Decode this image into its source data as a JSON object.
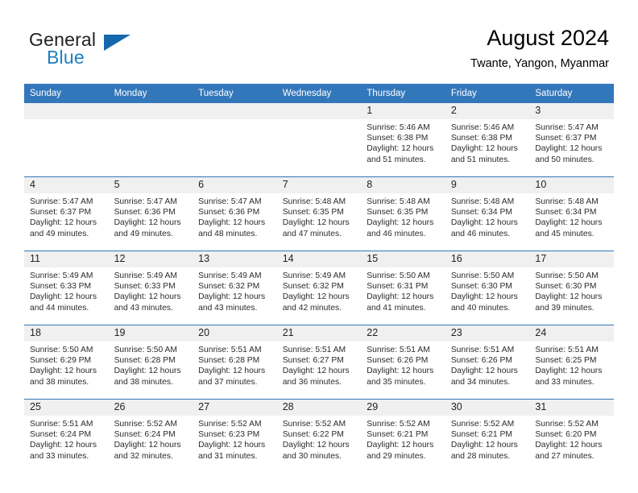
{
  "brand": {
    "word_one": "General",
    "word_two": "Blue",
    "triangle_color": "#1668ad",
    "blue_color": "#1b7fc4"
  },
  "header": {
    "title": "August 2024",
    "subtitle": "Twante, Yangon, Myanmar"
  },
  "theme": {
    "header_blue": "#3377bb",
    "daynum_band": "#f0f0f0"
  },
  "weekday_headers": [
    "Sunday",
    "Monday",
    "Tuesday",
    "Wednesday",
    "Thursday",
    "Friday",
    "Saturday"
  ],
  "labels": {
    "sunrise_prefix": "Sunrise:",
    "sunset_prefix": "Sunset:",
    "daylight_prefix": "Daylight:"
  },
  "weeks": [
    [
      {
        "day": "",
        "empty": true
      },
      {
        "day": "",
        "empty": true
      },
      {
        "day": "",
        "empty": true
      },
      {
        "day": "",
        "empty": true
      },
      {
        "day": "1",
        "sunrise": "Sunrise: 5:46 AM",
        "sunset": "Sunset: 6:38 PM",
        "daylight": "Daylight: 12 hours and 51 minutes."
      },
      {
        "day": "2",
        "sunrise": "Sunrise: 5:46 AM",
        "sunset": "Sunset: 6:38 PM",
        "daylight": "Daylight: 12 hours and 51 minutes."
      },
      {
        "day": "3",
        "sunrise": "Sunrise: 5:47 AM",
        "sunset": "Sunset: 6:37 PM",
        "daylight": "Daylight: 12 hours and 50 minutes."
      }
    ],
    [
      {
        "day": "4",
        "sunrise": "Sunrise: 5:47 AM",
        "sunset": "Sunset: 6:37 PM",
        "daylight": "Daylight: 12 hours and 49 minutes."
      },
      {
        "day": "5",
        "sunrise": "Sunrise: 5:47 AM",
        "sunset": "Sunset: 6:36 PM",
        "daylight": "Daylight: 12 hours and 49 minutes."
      },
      {
        "day": "6",
        "sunrise": "Sunrise: 5:47 AM",
        "sunset": "Sunset: 6:36 PM",
        "daylight": "Daylight: 12 hours and 48 minutes."
      },
      {
        "day": "7",
        "sunrise": "Sunrise: 5:48 AM",
        "sunset": "Sunset: 6:35 PM",
        "daylight": "Daylight: 12 hours and 47 minutes."
      },
      {
        "day": "8",
        "sunrise": "Sunrise: 5:48 AM",
        "sunset": "Sunset: 6:35 PM",
        "daylight": "Daylight: 12 hours and 46 minutes."
      },
      {
        "day": "9",
        "sunrise": "Sunrise: 5:48 AM",
        "sunset": "Sunset: 6:34 PM",
        "daylight": "Daylight: 12 hours and 46 minutes."
      },
      {
        "day": "10",
        "sunrise": "Sunrise: 5:48 AM",
        "sunset": "Sunset: 6:34 PM",
        "daylight": "Daylight: 12 hours and 45 minutes."
      }
    ],
    [
      {
        "day": "11",
        "sunrise": "Sunrise: 5:49 AM",
        "sunset": "Sunset: 6:33 PM",
        "daylight": "Daylight: 12 hours and 44 minutes."
      },
      {
        "day": "12",
        "sunrise": "Sunrise: 5:49 AM",
        "sunset": "Sunset: 6:33 PM",
        "daylight": "Daylight: 12 hours and 43 minutes."
      },
      {
        "day": "13",
        "sunrise": "Sunrise: 5:49 AM",
        "sunset": "Sunset: 6:32 PM",
        "daylight": "Daylight: 12 hours and 43 minutes."
      },
      {
        "day": "14",
        "sunrise": "Sunrise: 5:49 AM",
        "sunset": "Sunset: 6:32 PM",
        "daylight": "Daylight: 12 hours and 42 minutes."
      },
      {
        "day": "15",
        "sunrise": "Sunrise: 5:50 AM",
        "sunset": "Sunset: 6:31 PM",
        "daylight": "Daylight: 12 hours and 41 minutes."
      },
      {
        "day": "16",
        "sunrise": "Sunrise: 5:50 AM",
        "sunset": "Sunset: 6:30 PM",
        "daylight": "Daylight: 12 hours and 40 minutes."
      },
      {
        "day": "17",
        "sunrise": "Sunrise: 5:50 AM",
        "sunset": "Sunset: 6:30 PM",
        "daylight": "Daylight: 12 hours and 39 minutes."
      }
    ],
    [
      {
        "day": "18",
        "sunrise": "Sunrise: 5:50 AM",
        "sunset": "Sunset: 6:29 PM",
        "daylight": "Daylight: 12 hours and 38 minutes."
      },
      {
        "day": "19",
        "sunrise": "Sunrise: 5:50 AM",
        "sunset": "Sunset: 6:28 PM",
        "daylight": "Daylight: 12 hours and 38 minutes."
      },
      {
        "day": "20",
        "sunrise": "Sunrise: 5:51 AM",
        "sunset": "Sunset: 6:28 PM",
        "daylight": "Daylight: 12 hours and 37 minutes."
      },
      {
        "day": "21",
        "sunrise": "Sunrise: 5:51 AM",
        "sunset": "Sunset: 6:27 PM",
        "daylight": "Daylight: 12 hours and 36 minutes."
      },
      {
        "day": "22",
        "sunrise": "Sunrise: 5:51 AM",
        "sunset": "Sunset: 6:26 PM",
        "daylight": "Daylight: 12 hours and 35 minutes."
      },
      {
        "day": "23",
        "sunrise": "Sunrise: 5:51 AM",
        "sunset": "Sunset: 6:26 PM",
        "daylight": "Daylight: 12 hours and 34 minutes."
      },
      {
        "day": "24",
        "sunrise": "Sunrise: 5:51 AM",
        "sunset": "Sunset: 6:25 PM",
        "daylight": "Daylight: 12 hours and 33 minutes."
      }
    ],
    [
      {
        "day": "25",
        "sunrise": "Sunrise: 5:51 AM",
        "sunset": "Sunset: 6:24 PM",
        "daylight": "Daylight: 12 hours and 33 minutes."
      },
      {
        "day": "26",
        "sunrise": "Sunrise: 5:52 AM",
        "sunset": "Sunset: 6:24 PM",
        "daylight": "Daylight: 12 hours and 32 minutes."
      },
      {
        "day": "27",
        "sunrise": "Sunrise: 5:52 AM",
        "sunset": "Sunset: 6:23 PM",
        "daylight": "Daylight: 12 hours and 31 minutes."
      },
      {
        "day": "28",
        "sunrise": "Sunrise: 5:52 AM",
        "sunset": "Sunset: 6:22 PM",
        "daylight": "Daylight: 12 hours and 30 minutes."
      },
      {
        "day": "29",
        "sunrise": "Sunrise: 5:52 AM",
        "sunset": "Sunset: 6:21 PM",
        "daylight": "Daylight: 12 hours and 29 minutes."
      },
      {
        "day": "30",
        "sunrise": "Sunrise: 5:52 AM",
        "sunset": "Sunset: 6:21 PM",
        "daylight": "Daylight: 12 hours and 28 minutes."
      },
      {
        "day": "31",
        "sunrise": "Sunrise: 5:52 AM",
        "sunset": "Sunset: 6:20 PM",
        "daylight": "Daylight: 12 hours and 27 minutes."
      }
    ]
  ]
}
